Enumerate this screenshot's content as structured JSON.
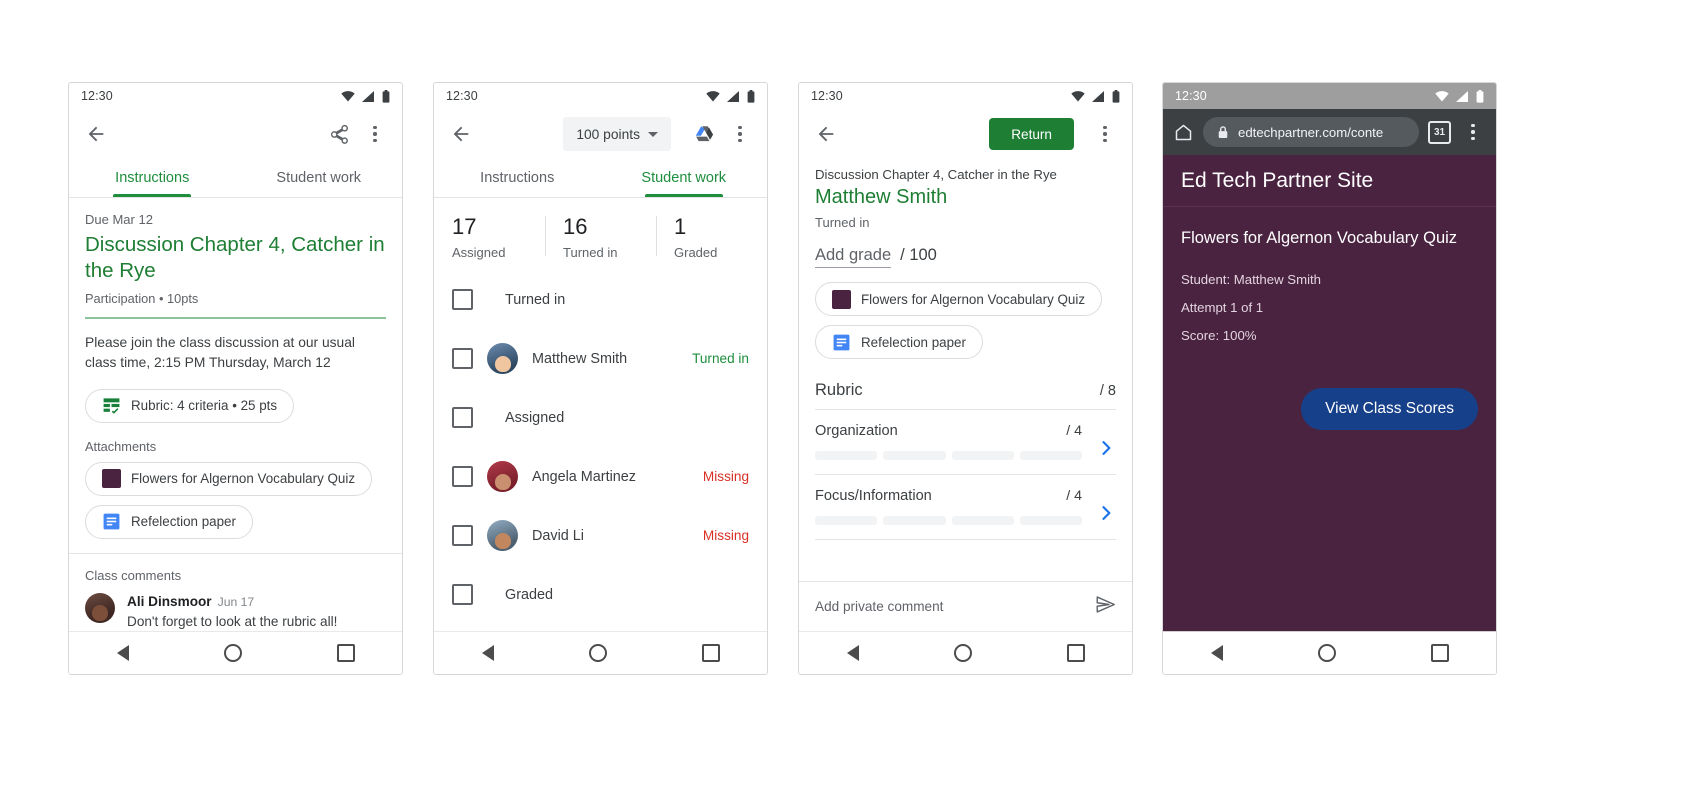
{
  "panels": {
    "assignment": {
      "status_time": "12:30",
      "icons": {
        "wifi": "wifi-icon",
        "signal": "signal-icon",
        "battery": "battery-icon"
      },
      "appbar": {
        "back": "back-arrow-icon",
        "share": "share-icon",
        "overflow": "overflow-menu-icon"
      },
      "tabs": [
        {
          "label": "Instructions",
          "active": true
        },
        {
          "label": "Student work",
          "active": false
        }
      ],
      "due": "Due Mar 12",
      "title": "Discussion Chapter 4, Catcher in the Rye",
      "meta": "Participation • 10pts",
      "description": "Please join the class discussion at our usual class time, 2:15 PM Thursday, March 12",
      "rubric_chip": {
        "label": "Rubric: 4 criteria • 25 pts",
        "icon": "rubric-grid-icon"
      },
      "attachments_label": "Attachments",
      "attachments": [
        {
          "label": "Flowers for Algernon Vocabulary Quiz",
          "icon": "quiz-square-icon",
          "color": "#4a2340"
        },
        {
          "label": "Refelection paper",
          "icon": "doc-icon",
          "color": "#4285f4"
        }
      ],
      "comments_label": "Class comments",
      "comment": {
        "author": "Ali Dinsmoor",
        "date": "Jun 17",
        "text": "Don't forget to look at the rubric all!"
      }
    },
    "student_work": {
      "status_time": "12:30",
      "points_button": "100 points",
      "drive_icon": "google-drive-icon",
      "overflow": "overflow-menu-icon",
      "tabs": [
        {
          "label": "Instructions",
          "active": false
        },
        {
          "label": "Student work",
          "active": true
        }
      ],
      "stats": [
        {
          "number": "17",
          "label": "Assigned"
        },
        {
          "number": "16",
          "label": "Turned in"
        },
        {
          "number": "1",
          "label": "Graded"
        }
      ],
      "rows": [
        {
          "type": "group",
          "label": "Turned in"
        },
        {
          "type": "student",
          "name": "Matthew Smith",
          "status": "Turned in",
          "status_kind": "turned",
          "avatar": "a2"
        },
        {
          "type": "group",
          "label": "Assigned"
        },
        {
          "type": "student",
          "name": "Angela Martinez",
          "status": "Missing",
          "status_kind": "missing",
          "avatar": "a3"
        },
        {
          "type": "student",
          "name": "David Li",
          "status": "Missing",
          "status_kind": "missing",
          "avatar": "a4"
        },
        {
          "type": "group",
          "label": "Graded"
        }
      ]
    },
    "grading": {
      "status_time": "12:30",
      "return_button": "Return",
      "overflow": "overflow-menu-icon",
      "assignment": "Discussion Chapter 4, Catcher in the Rye",
      "student": "Matthew Smith",
      "state": "Turned in",
      "add_grade": "Add grade",
      "out_of": "/ 100",
      "attachments": [
        {
          "label": "Flowers for Algernon Vocabulary Quiz",
          "icon": "quiz-square-icon",
          "color": "#4a2340"
        },
        {
          "label": "Refelection paper",
          "icon": "doc-icon",
          "color": "#4285f4"
        }
      ],
      "rubric_title": "Rubric",
      "rubric_total": "/ 8",
      "criteria": [
        {
          "name": "Organization",
          "score": "/ 4",
          "levels": 4
        },
        {
          "name": "Focus/Information",
          "score": "/ 4",
          "levels": 4
        }
      ],
      "private_comment_placeholder": "Add private comment",
      "send_icon": "send-icon"
    },
    "browser": {
      "status_time": "12:30",
      "home_icon": "home-icon",
      "lock_icon": "lock-icon",
      "url": "edtechpartner.com/conte",
      "tab_count": "31",
      "overflow": "overflow-menu-icon",
      "site_title": "Ed Tech Partner Site",
      "page_heading": "Flowers for Algernon Vocabulary Quiz",
      "lines": [
        "Student: Matthew Smith",
        "Attempt 1 of 1",
        "Score: 100%"
      ],
      "cta_button": "View Class Scores",
      "theme_color": "#4a2340",
      "cta_color": "#16418a"
    }
  },
  "navbar": {
    "back": "nav-back-icon",
    "home": "nav-home-icon",
    "recents": "nav-recents-icon"
  }
}
